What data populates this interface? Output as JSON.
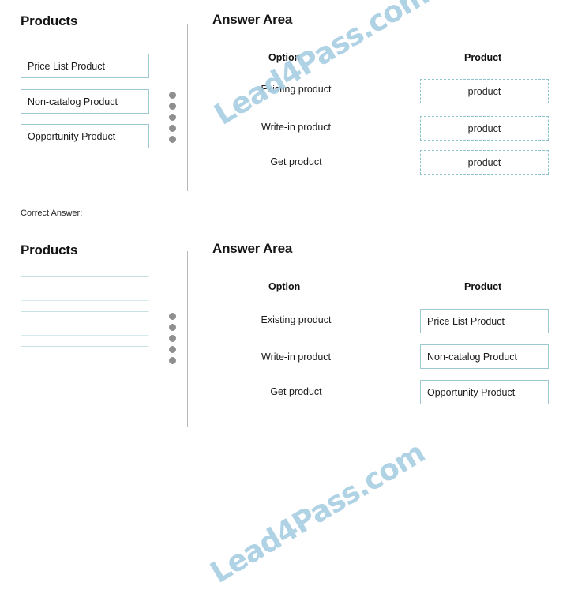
{
  "watermark": {
    "text": "Lead4Pass.com",
    "color": "#a9cfe3"
  },
  "correct_answer_label": "Correct Answer:",
  "question_panel": {
    "products_title": "Products",
    "answer_area_title": "Answer Area",
    "columns": {
      "option": "Option",
      "product": "Product"
    },
    "source_products": [
      "Price List Product",
      "Non-catalog Product",
      "Opportunity Product"
    ],
    "options": [
      "Existing product",
      "Write-in product",
      "Get product"
    ],
    "drop_targets": [
      "product",
      "product",
      "product"
    ]
  },
  "answer_panel": {
    "products_title": "Products",
    "answer_area_title": "Answer Area",
    "columns": {
      "option": "Option",
      "product": "Product"
    },
    "source_products": [
      "",
      "",
      ""
    ],
    "options": [
      "Existing product",
      "Write-in product",
      "Get product"
    ],
    "drop_targets": [
      "Price List Product",
      "Non-catalog Product",
      "Opportunity Product"
    ]
  },
  "colors": {
    "chip_border": "#9cc9cf",
    "drop_dashed_border": "#8dc3cc",
    "divider": "#b9b9b9",
    "dot": "#8f8f8f",
    "text": "#1b1b1b"
  }
}
